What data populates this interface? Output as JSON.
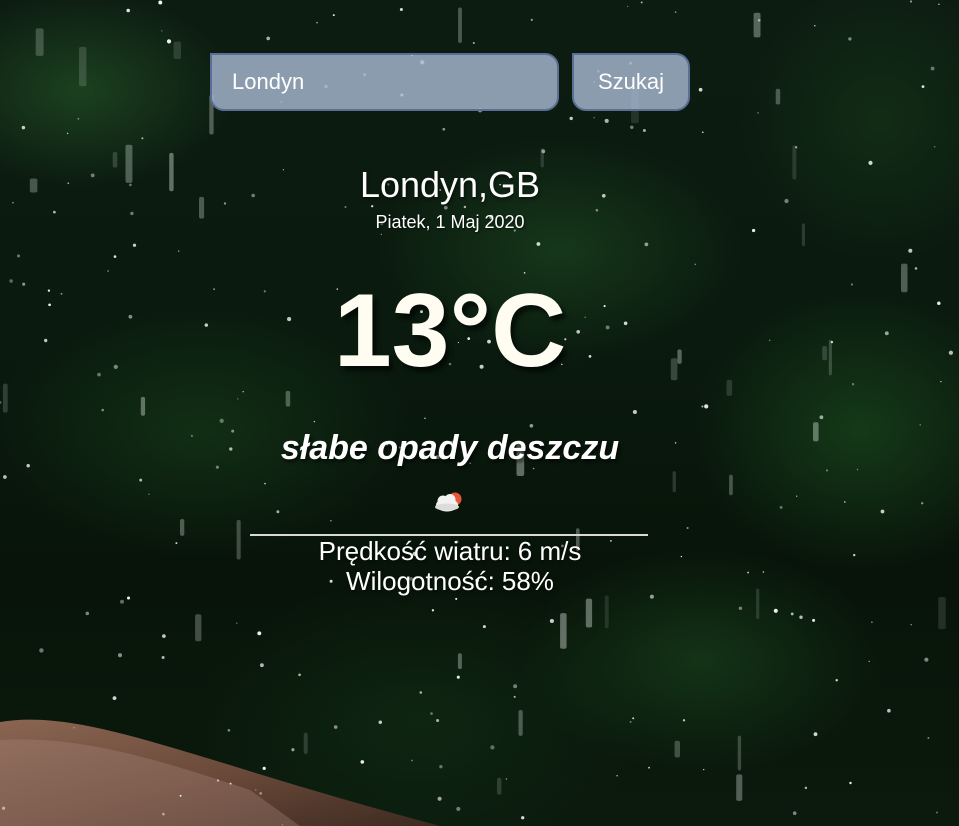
{
  "search": {
    "value": "Londyn",
    "button_label": "Szukaj"
  },
  "weather": {
    "location": "Londyn,GB",
    "date": "Piatek, 1 Maj 2020",
    "temperature": "13°C",
    "description": "słabe opady deszczu",
    "icon": "cloud-sun-rain-icon",
    "wind_label": "Prędkość wiatru:",
    "wind_value": "6 m/s",
    "humidity_label": "Wilogotność:",
    "humidity_value": "58%"
  },
  "colors": {
    "background": "#0a1a0e",
    "input_fill": "#afc0dc",
    "input_border": "#5a6f96",
    "temperature_text": "#fffdf2",
    "icon_sun": "#e8553a"
  }
}
